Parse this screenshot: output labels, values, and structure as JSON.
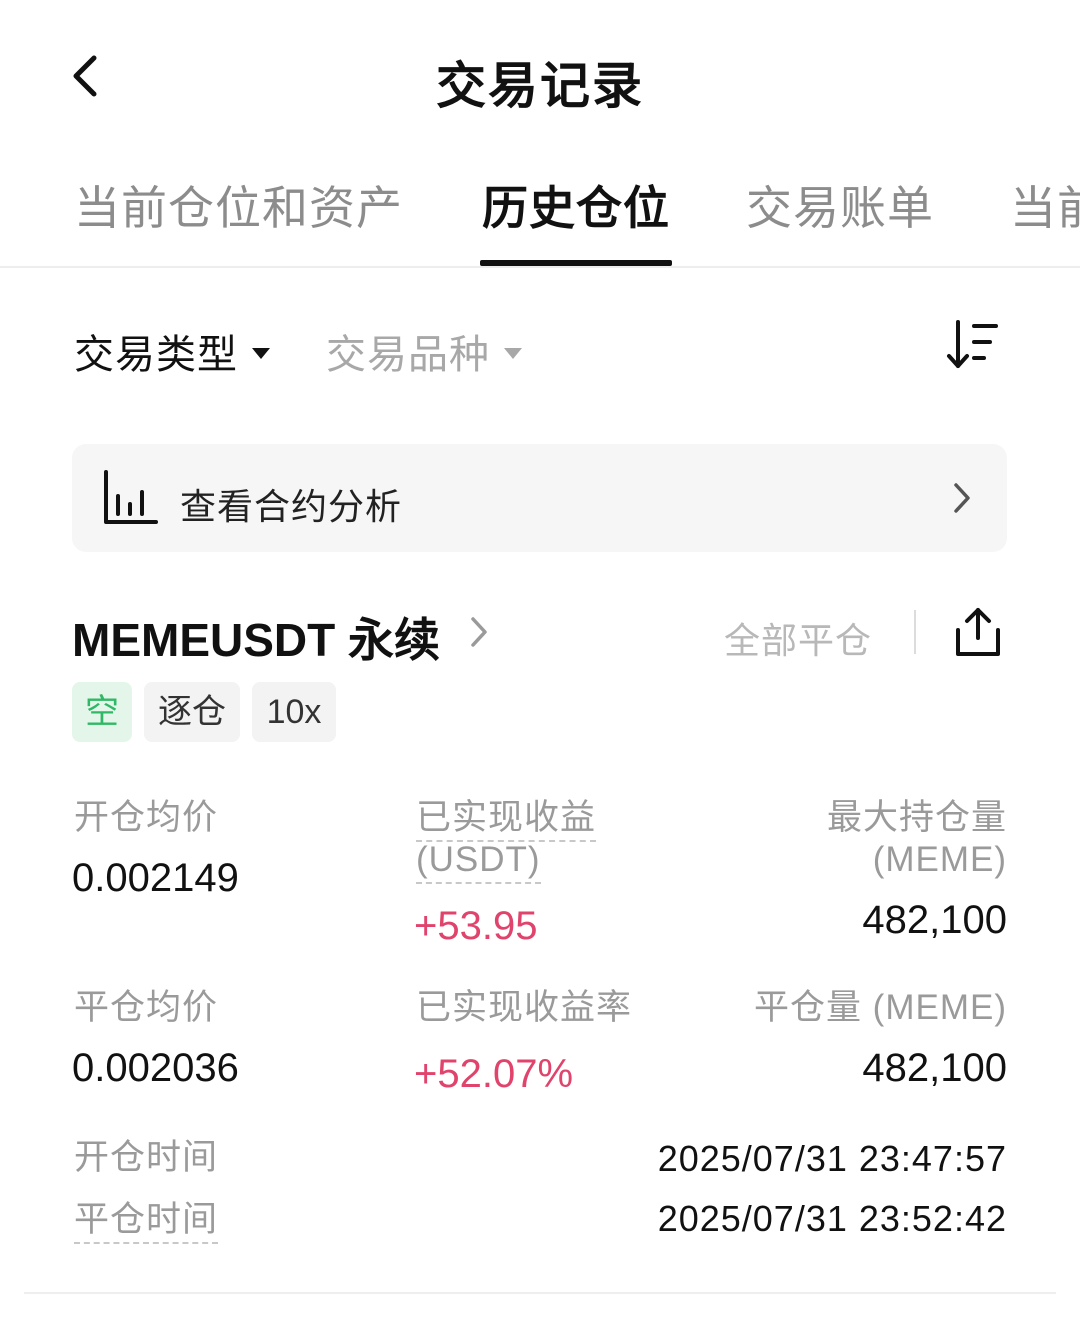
{
  "header": {
    "title": "交易记录"
  },
  "tabs": [
    {
      "label": "当前仓位和资产",
      "active": false
    },
    {
      "label": "历史仓位",
      "active": true
    },
    {
      "label": "交易账单",
      "active": false
    },
    {
      "label": "当前",
      "active": false
    }
  ],
  "filters": {
    "trade_type": "交易类型",
    "trade_symbol": "交易品种"
  },
  "analysis": {
    "label": "查看合约分析"
  },
  "position": {
    "symbol": "MEMEUSDT 永续",
    "close_all": "全部平仓",
    "tags": {
      "side": "空",
      "margin_mode": "逐仓",
      "leverage": "10x"
    },
    "open_avg_price_label": "开仓均价",
    "open_avg_price": "0.002149",
    "realized_pnl_label_line1": "已实现收益",
    "realized_pnl_label_line2": "(USDT)",
    "realized_pnl": "+53.95",
    "max_position_label_line1": "最大持仓量",
    "max_position_label_line2": "(MEME)",
    "max_position": "482,100",
    "close_avg_price_label": "平仓均价",
    "close_avg_price": "0.002036",
    "realized_pnl_rate_label": "已实现收益率",
    "realized_pnl_rate": "+52.07%",
    "close_amount_label": "平仓量 (MEME)",
    "close_amount": "482,100",
    "open_time_label": "开仓时间",
    "open_time": "2025/07/31 23:47:57",
    "close_time_label": "平仓时间",
    "close_time": "2025/07/31 23:52:42"
  },
  "colors": {
    "positive": "#e0436b",
    "short_tag": "#2fb866",
    "short_tag_bg": "#e4f6ea",
    "muted": "#9a9a9a"
  },
  "icons": {
    "back": "chevron-left-icon",
    "sort": "sort-descending-icon",
    "analysis": "bar-chart-icon",
    "share": "share-upload-icon"
  }
}
